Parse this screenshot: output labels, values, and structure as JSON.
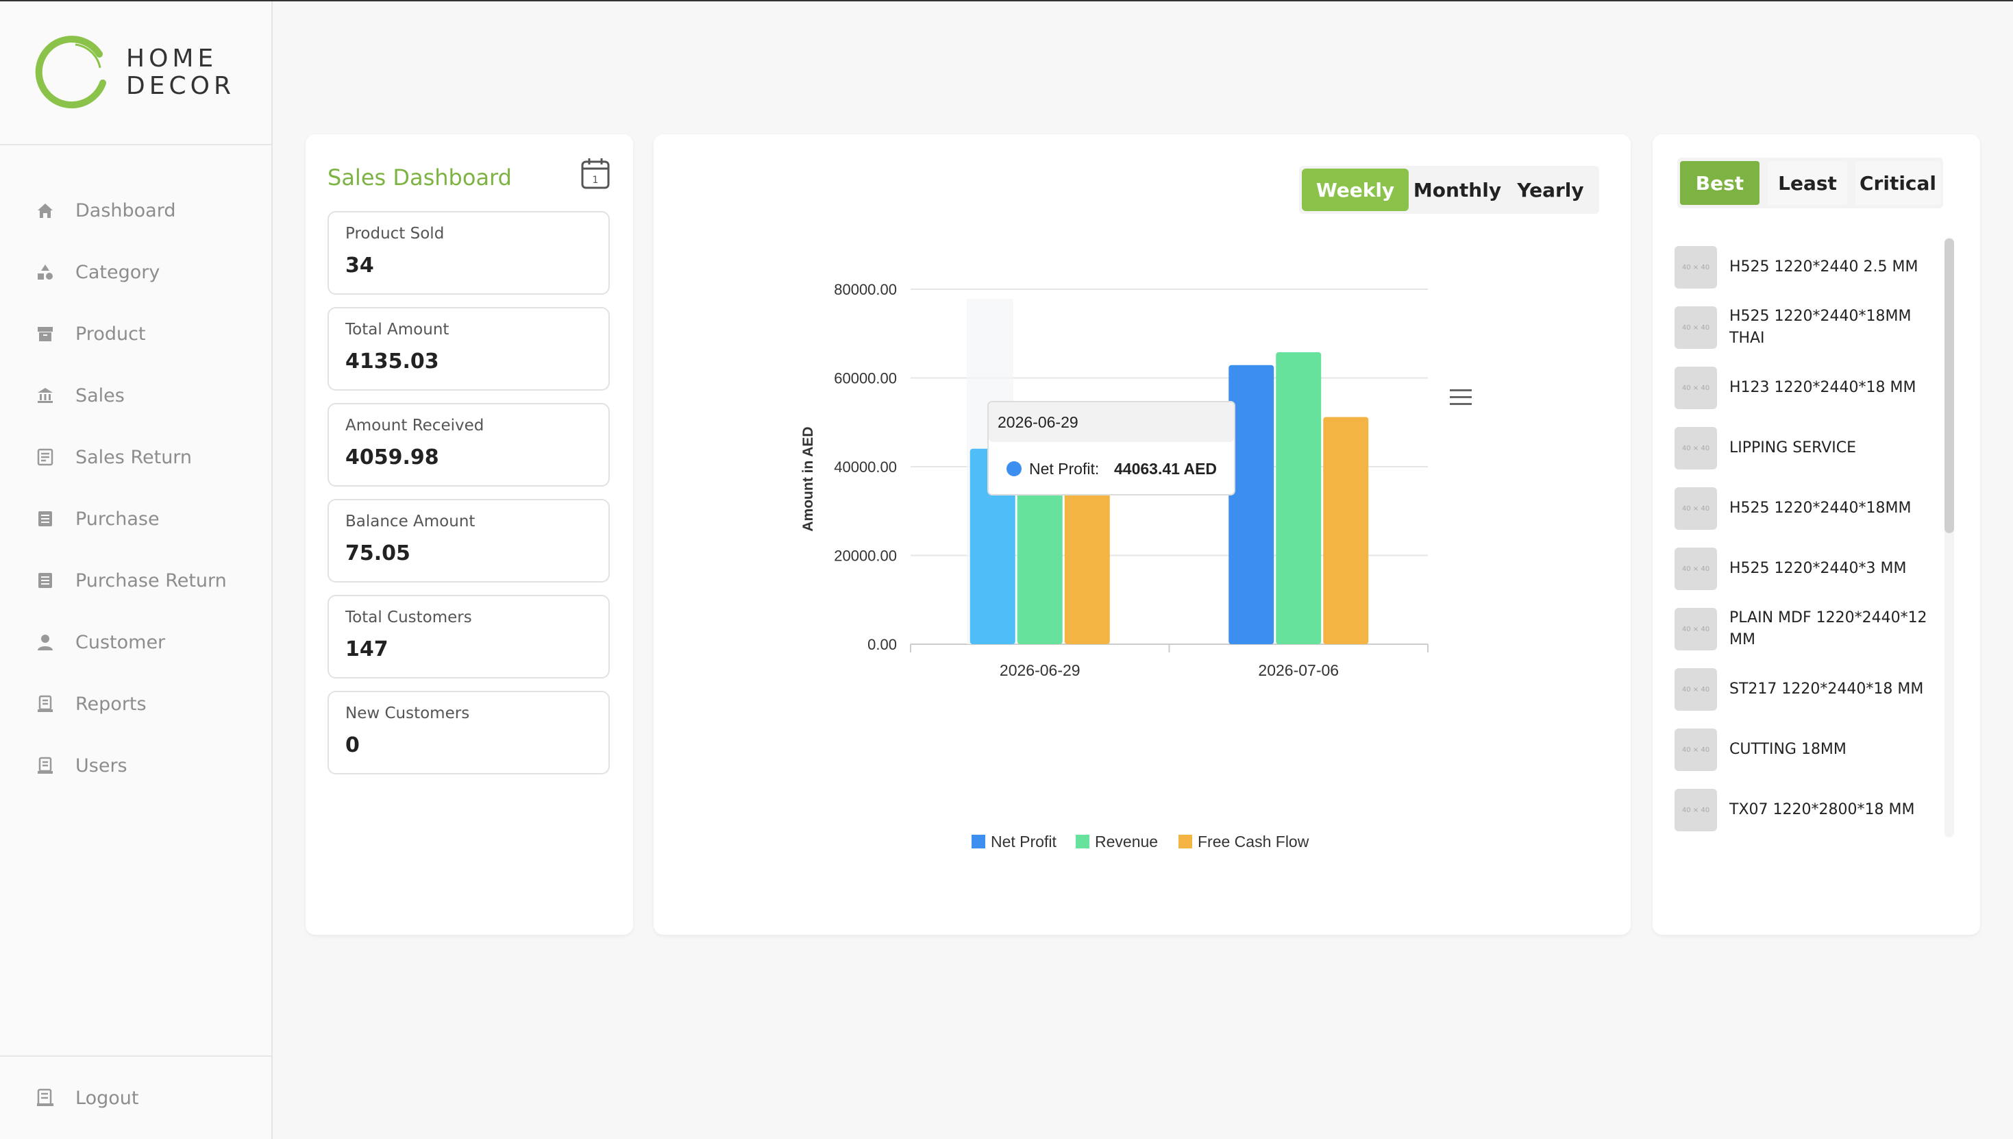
{
  "brand": {
    "line1": "HOME",
    "line2": "DECOR",
    "accent": "#8bc34a"
  },
  "sidebar": {
    "items": [
      {
        "label": "Dashboard",
        "icon": "home-icon"
      },
      {
        "label": "Category",
        "icon": "shapes-icon"
      },
      {
        "label": "Product",
        "icon": "archive-icon"
      },
      {
        "label": "Sales",
        "icon": "bank-icon"
      },
      {
        "label": "Sales Return",
        "icon": "receipt-icon"
      },
      {
        "label": "Purchase",
        "icon": "list-icon"
      },
      {
        "label": "Purchase Return",
        "icon": "list-icon"
      },
      {
        "label": "Customer",
        "icon": "user-icon"
      },
      {
        "label": "Reports",
        "icon": "report-icon"
      },
      {
        "label": "Users",
        "icon": "report-icon"
      }
    ],
    "logout": "Logout"
  },
  "summary": {
    "title": "Sales Dashboard",
    "stats": [
      {
        "label": "Product Sold",
        "value": "34"
      },
      {
        "label": "Total Amount",
        "value": "4135.03"
      },
      {
        "label": "Amount Received",
        "value": "4059.98"
      },
      {
        "label": "Balance Amount",
        "value": "75.05"
      },
      {
        "label": "Total Customers",
        "value": "147"
      },
      {
        "label": "New Customers",
        "value": "0"
      }
    ]
  },
  "period_tabs": {
    "weekly": "Weekly",
    "monthly": "Monthly",
    "yearly": "Yearly",
    "active": "Weekly"
  },
  "chart_data": {
    "type": "bar",
    "categories": [
      "2026-06-29",
      "2026-07-06"
    ],
    "series": [
      {
        "name": "Net Profit",
        "values": [
          44063.41,
          62900
        ],
        "color": "#3d8fef"
      },
      {
        "name": "Revenue",
        "values": [
          47000,
          65800
        ],
        "color": "#66e29c"
      },
      {
        "name": "Free Cash Flow",
        "values": [
          43700,
          51200
        ],
        "color": "#f3b443"
      }
    ],
    "ylabel": "Amount in AED",
    "yticks": [
      "0.00",
      "20000.00",
      "40000.00",
      "60000.00",
      "80000.00"
    ],
    "ylim": [
      0,
      80000
    ],
    "grid": true,
    "legend": "bottom",
    "tooltip": {
      "category": "2026-06-29",
      "series": "Net Profit:",
      "value": "44063.41 AED"
    }
  },
  "rank_tabs": {
    "best": "Best",
    "least": "Least",
    "critical": "Critical"
  },
  "products": [
    "H525 1220*2440 2.5 MM",
    "H525 1220*2440*18MM THAI",
    "H123 1220*2440*18 MM",
    "LIPPING SERVICE",
    "H525 1220*2440*18MM",
    "H525 1220*2440*3 MM",
    "PLAIN MDF 1220*2440*12 MM",
    "ST217 1220*2440*18 MM",
    "CUTTING 18MM",
    "TX07 1220*2800*18 MM"
  ],
  "thumb_label": "40 × 40"
}
